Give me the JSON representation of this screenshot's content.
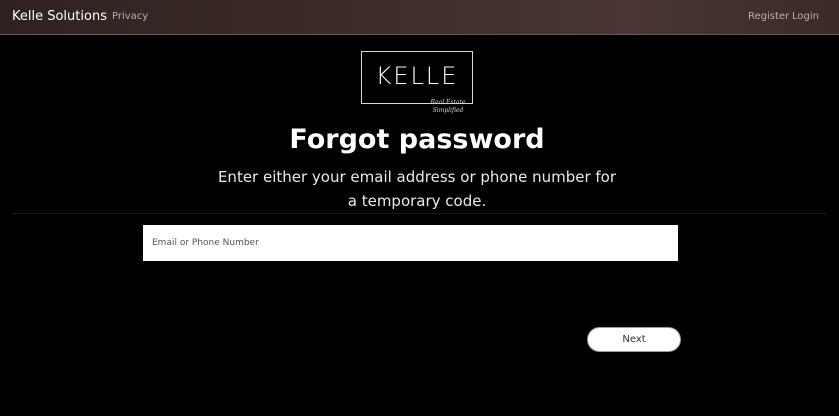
{
  "navbar": {
    "brand": "Kelle Solutions",
    "privacy_label": "Privacy",
    "register_label": "Register",
    "login_label": "Login"
  },
  "logo": {
    "word": "KELLE",
    "tagline_line1": "Real Estate",
    "tagline_line2": "Simplified"
  },
  "form": {
    "title": "Forgot password",
    "subtitle": "Enter either your email address or phone number for a temporary code.",
    "input_value": "",
    "input_placeholder": "Email or Phone Number",
    "next_label": "Next"
  },
  "colors": {
    "background": "#000000",
    "navbar": "#3a2a27",
    "text": "#ffffff",
    "nav_link": "#b9aeab"
  }
}
